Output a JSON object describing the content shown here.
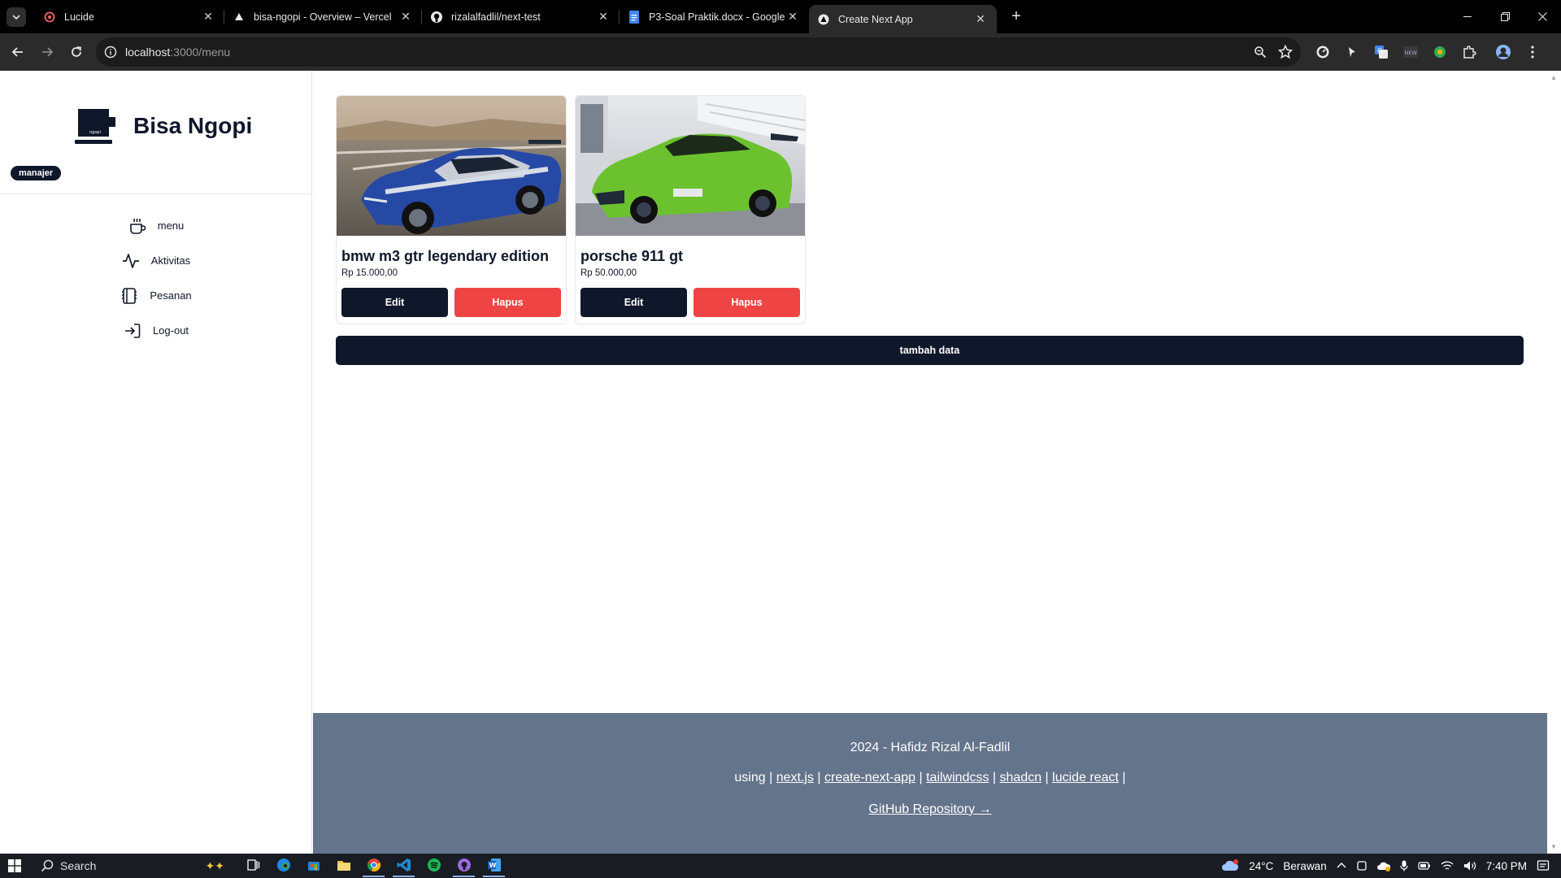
{
  "browser": {
    "tabs": [
      {
        "title": "Lucide",
        "favicon": "lucide-icon",
        "active": false
      },
      {
        "title": "bisa-ngopi - Overview – Vercel",
        "favicon": "vercel-icon",
        "active": false
      },
      {
        "title": "rizalalfadlil/next-test",
        "favicon": "github-icon",
        "active": false
      },
      {
        "title": "P3-Soal Praktik.docx - Google Docs",
        "favicon": "docs-icon",
        "active": false
      },
      {
        "title": "Create Next App",
        "favicon": "nextjs-icon",
        "active": true
      }
    ],
    "url_host": "localhost",
    "url_path": ":3000/menu"
  },
  "app": {
    "brand": "Bisa Ngopi",
    "logo_text": "ngopi",
    "role": "manajer",
    "nav": [
      {
        "label": "menu",
        "icon": "coffee-icon"
      },
      {
        "label": "Aktivitas",
        "icon": "activity-icon"
      },
      {
        "label": "Pesanan",
        "icon": "receipt-icon"
      },
      {
        "label": "Log-out",
        "icon": "log-out-icon"
      }
    ],
    "cards": [
      {
        "name": "bmw m3 gtr legendary edition",
        "price": "Rp 15.000,00",
        "edit": "Edit",
        "delete": "Hapus",
        "image": "blue-silver-bmw-race-car"
      },
      {
        "name": "porsche 911 gt",
        "price": "Rp 50.000,00",
        "edit": "Edit",
        "delete": "Hapus",
        "image": "green-porsche-911"
      }
    ],
    "add_button": "tambah data"
  },
  "footer": {
    "credit": "2024 - Hafidz Rizal Al-Fadlil",
    "using": "using",
    "links": [
      "next.js",
      "create-next-app",
      "tailwindcss",
      "shadcn",
      "lucide react"
    ],
    "repo": "GitHub Repository →"
  },
  "taskbar": {
    "search": "Search",
    "weather": "24°C",
    "weather_desc": "Berawan",
    "time": "7:40 PM"
  },
  "colors": {
    "primary": "#0f172a",
    "danger": "#ef4444",
    "footer": "#64748b"
  }
}
